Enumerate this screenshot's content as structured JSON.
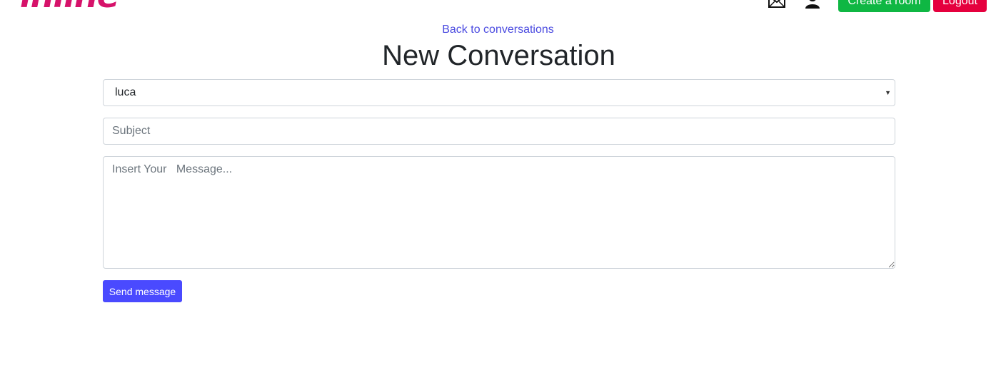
{
  "header": {
    "logo_text": "inline",
    "mail_icon": "mail-icon",
    "user_icon": "user-icon",
    "create_room_label": "Create a room",
    "logout_label": "Logout",
    "colors": {
      "logo": "#d6126a",
      "create_room": "#0fb743",
      "logout": "#e5003e"
    }
  },
  "main": {
    "back_link": "Back to conversations",
    "title": "New Conversation",
    "recipient_select": {
      "selected": "luca"
    },
    "subject_input": {
      "value": "",
      "placeholder": "Subject"
    },
    "message_textarea": {
      "value": "",
      "placeholder": "Insert Your   Message..."
    },
    "send_button_label": "Send message",
    "colors": {
      "link": "#4a4ae0",
      "send_button": "#4a4aff"
    }
  }
}
